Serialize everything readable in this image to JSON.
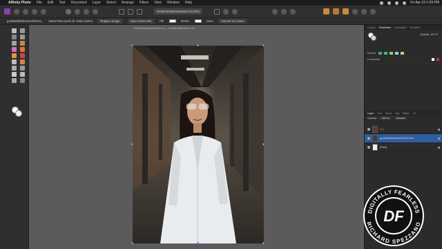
{
  "menubar": {
    "app_name": "Affinity Photo",
    "items": [
      "File",
      "Edit",
      "Text",
      "Document",
      "Layer",
      "Select",
      "Arrange",
      "Filters",
      "View",
      "Window",
      "Help"
    ],
    "clock": "Fri Apr 23  1:09 PM"
  },
  "toolbar": {
    "document_title": "Drealernmaynteinphotos (21.8%)"
  },
  "context": {
    "file_info": "gos5689bb60c6e2e0f3F51...",
    "pixel_info": "5304x7952 pixels @ 72dpi (100%)",
    "replace_image": "Replace Image",
    "open_stock_url": "Open Stock URL",
    "fill_label": "Fill:",
    "stroke_label": "Stroke:",
    "none_label": "None",
    "convert_to_curves": "Convert to Curves"
  },
  "canvas": {
    "doc_tab_label": "Drealernmaynteinphotos (s) — Drealertnaytonphoto (s)"
  },
  "right_panel": {
    "tabs": [
      "Colour",
      "Swatches",
      "Character",
      "Brushes"
    ],
    "active_tab": "Swatches",
    "opacity_label": "Opacity:",
    "opacity_value": "100 %",
    "recent_label": "Recent:",
    "palette_name": "▾ essential",
    "colors": {
      "recent": [
        "#3aa3b5",
        "#48b77e",
        "#a4c95f",
        "#9ad0d6",
        "#c7cc7a"
      ]
    }
  },
  "layers": {
    "tabs": [
      "Layers",
      "Effects",
      "Styles",
      "Adjustments",
      "Stock",
      "Navigator"
    ],
    "tab_labels": [
      "Layer",
      "Fex",
      "Stock",
      "Adj",
      "Styles",
      "Fx"
    ],
    "opacity_label": "Opacity:",
    "opacity_value": "100 %",
    "blend_mode": "Normal",
    "rows": [
      {
        "name": "(Pt)",
        "selected": false
      },
      {
        "name": "gos5689bb60c6e2e0f3F51926",
        "selected": true
      },
      {
        "name": "(Pixel)",
        "selected": false
      }
    ]
  },
  "watermark": {
    "top_text": "DIGITALLY FEARLESS",
    "bottom_text": "RICHARD SPEZZANO",
    "monogram": "DF"
  }
}
